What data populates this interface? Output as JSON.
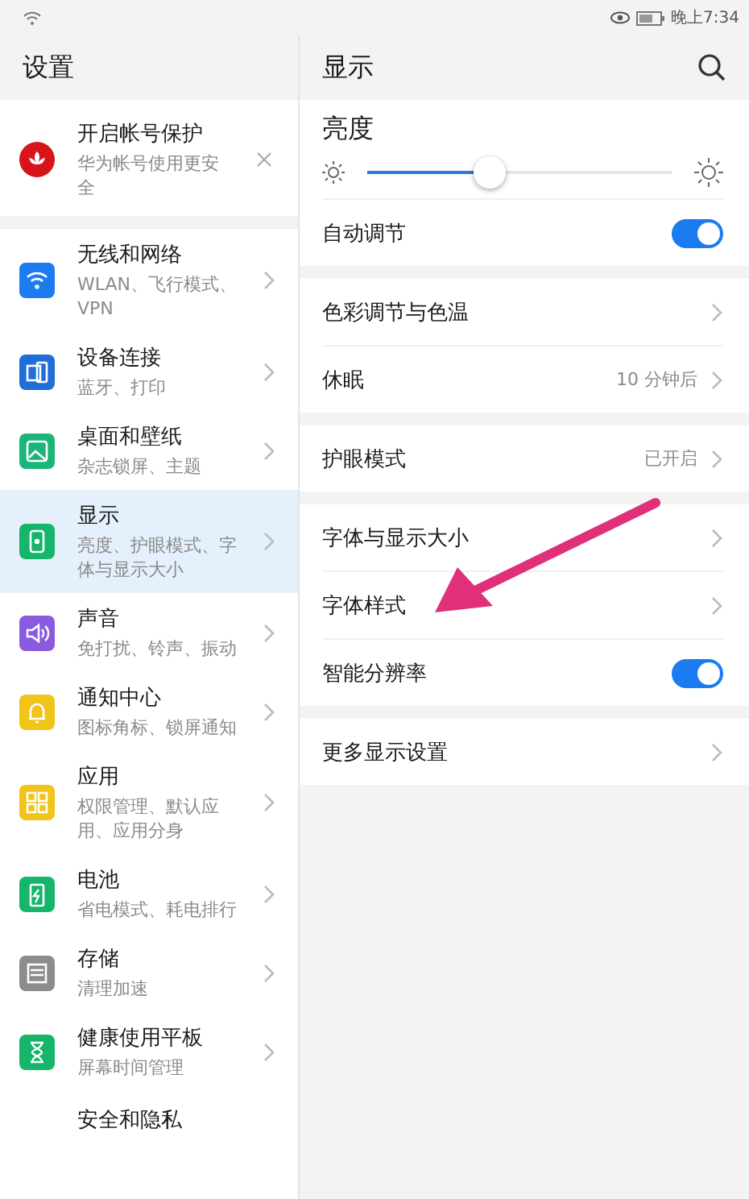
{
  "status_bar": {
    "time": "晚上7:34"
  },
  "sidebar": {
    "title": "设置",
    "items": [
      {
        "kind": "account",
        "title": "开启帐号保护",
        "subtitle": "华为帐号使用更安全",
        "color": "#d7141a",
        "selected": false
      },
      {
        "kind": "menu",
        "title": "无线和网络",
        "subtitle": "WLAN、飞行模式、VPN",
        "color": "#1a7cf0",
        "selected": false
      },
      {
        "kind": "menu",
        "title": "设备连接",
        "subtitle": "蓝牙、打印",
        "color": "#1f6fd6",
        "selected": false
      },
      {
        "kind": "menu",
        "title": "桌面和壁纸",
        "subtitle": "杂志锁屏、主题",
        "color": "#1bb57a",
        "selected": false
      },
      {
        "kind": "menu",
        "title": "显示",
        "subtitle": "亮度、护眼模式、字体与显示大小",
        "color": "#15b56a",
        "selected": true
      },
      {
        "kind": "menu",
        "title": "声音",
        "subtitle": "免打扰、铃声、振动",
        "color": "#8a5be0",
        "selected": false
      },
      {
        "kind": "menu",
        "title": "通知中心",
        "subtitle": "图标角标、锁屏通知",
        "color": "#f0c419",
        "selected": false
      },
      {
        "kind": "menu",
        "title": "应用",
        "subtitle": "权限管理、默认应用、应用分身",
        "color": "#f0c419",
        "selected": false
      },
      {
        "kind": "menu",
        "title": "电池",
        "subtitle": "省电模式、耗电排行",
        "color": "#15b56a",
        "selected": false
      },
      {
        "kind": "menu",
        "title": "存储",
        "subtitle": "清理加速",
        "color": "#8c8c8c",
        "selected": false
      },
      {
        "kind": "menu",
        "title": "健康使用平板",
        "subtitle": "屏幕时间管理",
        "color": "#15b56a",
        "selected": false
      },
      {
        "kind": "menu",
        "title": "安全和隐私",
        "selected": false
      }
    ]
  },
  "content": {
    "title": "显示",
    "sections": [
      [
        {
          "kind": "slider",
          "label": "亮度",
          "level": 0.4
        },
        {
          "kind": "switch",
          "label": "自动调节",
          "on": true
        }
      ],
      [
        {
          "kind": "link",
          "label": "色彩调节与色温"
        },
        {
          "kind": "link",
          "label": "休眠",
          "value": "10 分钟后"
        }
      ],
      [
        {
          "kind": "link",
          "label": "护眼模式",
          "value": "已开启"
        }
      ],
      [
        {
          "kind": "link",
          "label": "字体与显示大小"
        },
        {
          "kind": "link",
          "label": "字体样式"
        },
        {
          "kind": "switch",
          "label": "智能分辨率",
          "on": true
        }
      ],
      [
        {
          "kind": "link",
          "label": "更多显示设置"
        }
      ]
    ]
  }
}
